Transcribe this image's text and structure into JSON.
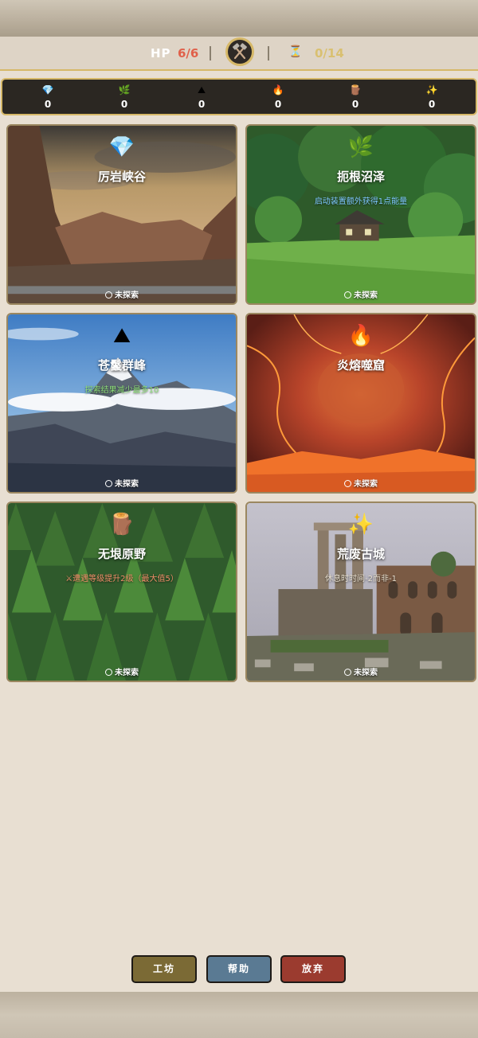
{
  "status": {
    "hp_label": "HP",
    "hp_value": "6/6",
    "emblem_icon": "crossed-hammers-icon",
    "turn_icon": "hourglass-icon",
    "turn_value": "0/14"
  },
  "resources": [
    {
      "icon": "💎",
      "name": "gem-icon",
      "value": "0"
    },
    {
      "icon": "🌿",
      "name": "herb-icon",
      "value": "0"
    },
    {
      "icon": "⛰",
      "name": "ore-icon",
      "value": "0"
    },
    {
      "icon": "🔥",
      "name": "fire-icon",
      "value": "0"
    },
    {
      "icon": "🪵",
      "name": "wood-icon",
      "value": "0"
    },
    {
      "icon": "✨",
      "name": "sparkle-icon",
      "value": "0"
    }
  ],
  "locations": [
    {
      "icon": "💎",
      "name": "厉岩峡谷",
      "effect": "",
      "status": "未探索",
      "effect_color": "#ffffff"
    },
    {
      "icon": "🌿",
      "name": "扼根沼泽",
      "effect": "启动装置额外获得1点能量",
      "status": "未探索",
      "effect_color": "#7fc8ff"
    },
    {
      "icon": "⛰",
      "name": "苍鬣群峰",
      "effect": "探索结果减少最多10",
      "status": "未探索",
      "effect_color": "#8fe07a"
    },
    {
      "icon": "🔥",
      "name": "炎熔噬窟",
      "effect": "",
      "status": "未探索",
      "effect_color": "#ffffff"
    },
    {
      "icon": "🪵",
      "name": "无垠原野",
      "effect": "⚔遭遇等级提升2级（最大值5）",
      "status": "未探索",
      "effect_color": "#f0906a"
    },
    {
      "icon": "✨",
      "name": "荒废古城",
      "effect": "休息时时间-2而非-1",
      "status": "未探索",
      "effect_color": "#e8e0d0"
    }
  ],
  "buttons": {
    "workshop": "工坊",
    "help": "帮助",
    "quit": "放弃"
  },
  "colors": {
    "gold_border": "#d6b868",
    "hp_red": "#e0604a",
    "workshop_btn": "#7b6a35",
    "help_btn": "#5a7a93",
    "quit_btn": "#9b3b2f"
  }
}
